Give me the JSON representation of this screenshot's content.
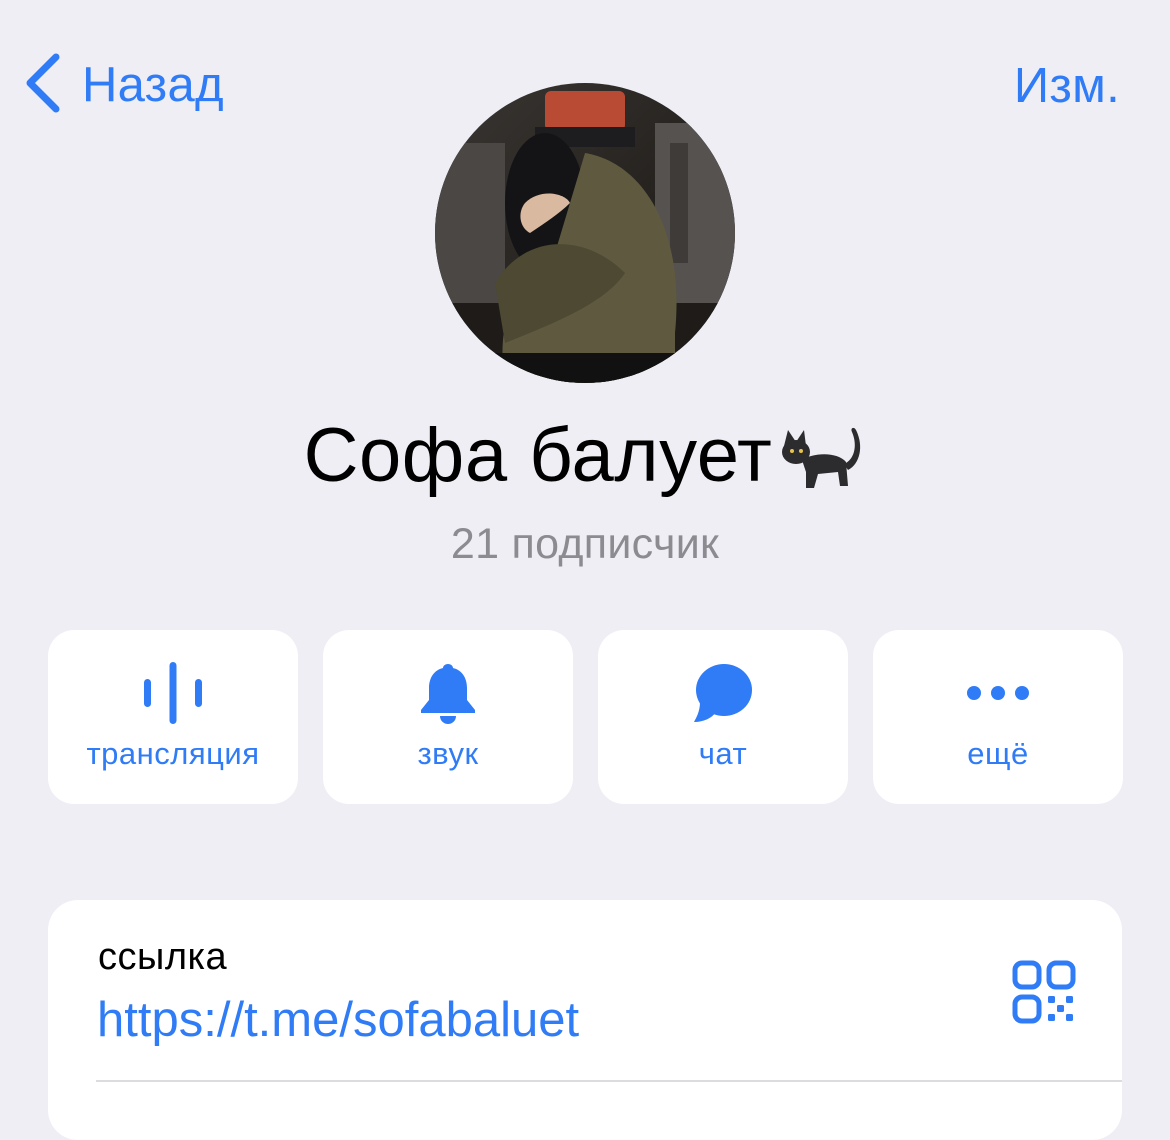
{
  "nav": {
    "back_label": "Назад",
    "edit_label": "Изм."
  },
  "channel": {
    "title": "Софа балует",
    "title_emoji": "cat-emoji",
    "subscribers": "21 подписчик",
    "avatar": "profile-photo"
  },
  "actions": [
    {
      "label": "трансляция",
      "icon": "waveform-icon"
    },
    {
      "label": "звук",
      "icon": "bell-icon"
    },
    {
      "label": "чат",
      "icon": "chat-bubble-icon"
    },
    {
      "label": "ещё",
      "icon": "more-dots-icon"
    }
  ],
  "info": {
    "link_caption": "ссылка",
    "link_value": "https://t.me/sofabaluet",
    "qr_icon": "qr-code-icon"
  },
  "colors": {
    "accent": "#2f7cf6",
    "background": "#efeef5",
    "card": "#ffffff",
    "secondary_text": "#8b8b90"
  }
}
